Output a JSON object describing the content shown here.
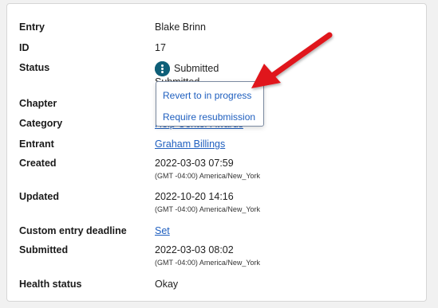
{
  "rows": {
    "entry": {
      "label": "Entry",
      "value": "Blake Brinn"
    },
    "id": {
      "label": "ID",
      "value": "17"
    },
    "status": {
      "label": "Status",
      "value": "Submitted",
      "obscured_value": "Submitted"
    },
    "chapter": {
      "label": "Chapter"
    },
    "category": {
      "label": "Category",
      "value": "Help Center Awards"
    },
    "entrant": {
      "label": "Entrant",
      "value": "Graham Billings"
    },
    "created": {
      "label": "Created",
      "value": "2022-03-03 07:59",
      "tz": "(GMT -04:00) America/New_York"
    },
    "updated": {
      "label": "Updated",
      "value": "2022-10-20 14:16",
      "tz": "(GMT -04:00) America/New_York"
    },
    "deadline": {
      "label": "Custom entry deadline",
      "value": "Set"
    },
    "submitted": {
      "label": "Submitted",
      "value": "2022-03-03 08:02",
      "tz": "(GMT -04:00) America/New_York"
    },
    "health": {
      "label": "Health status",
      "value": "Okay"
    }
  },
  "status_menu": {
    "items": [
      "Revert to in progress",
      "Require resubmission"
    ]
  },
  "colors": {
    "link": "#1f5fbf",
    "kebab": "#0e5f78",
    "annotation_arrow": "#e0161c"
  },
  "icons": {
    "menu": "kebab-vertical-icon",
    "annotation": "red-arrow-icon"
  }
}
